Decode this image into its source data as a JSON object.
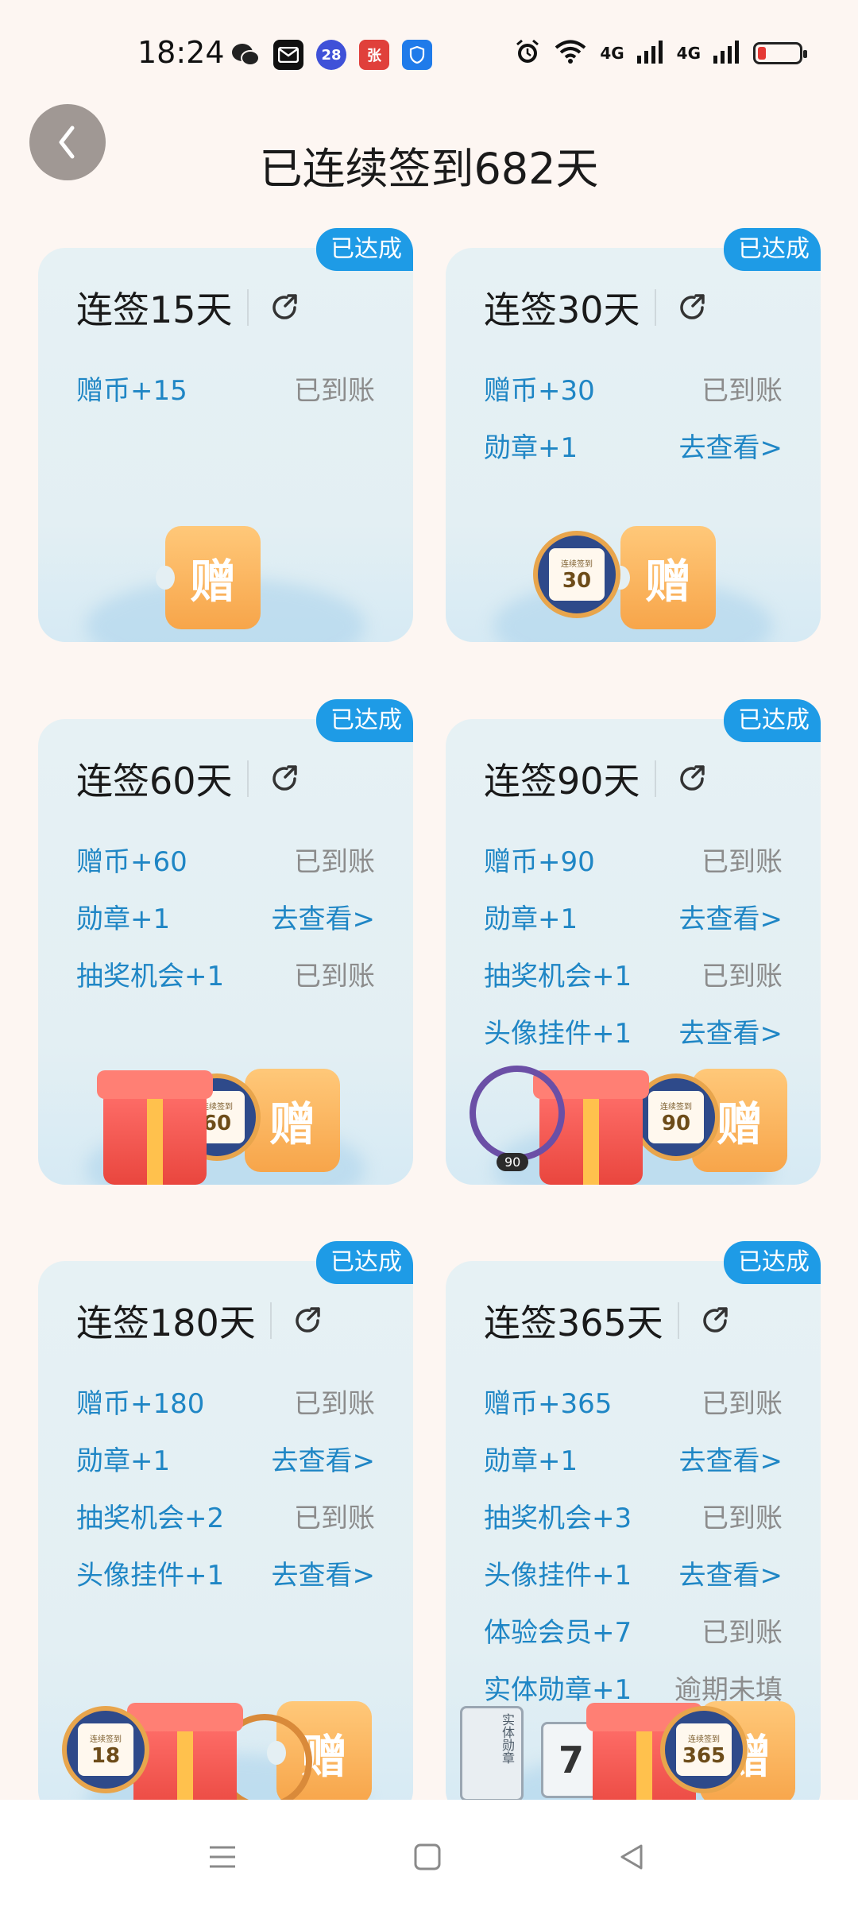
{
  "status_bar": {
    "time": "18:24",
    "app_icons": [
      {
        "name": "wechat-icon",
        "label": "",
        "color": "#222222"
      },
      {
        "name": "mail-icon",
        "label": "",
        "color": "#111111"
      },
      {
        "name": "calendar-icon",
        "label": "28",
        "color": "#3F51D8"
      },
      {
        "name": "zhang-app-icon",
        "label": "张",
        "color": "#E0403B"
      },
      {
        "name": "shield-app-icon",
        "label": "",
        "color": "#1F7BEA"
      }
    ],
    "signal1": "4G",
    "signal2": "4G",
    "battery_level": 0.2
  },
  "header": {
    "title": "已连续签到682天"
  },
  "cards": [
    {
      "badge": "已达成",
      "title": "连签15天",
      "rows": [
        {
          "label": "赠币+15",
          "status": "已到账",
          "link": false
        }
      ]
    },
    {
      "badge": "已达成",
      "title": "连签30天",
      "rows": [
        {
          "label": "赠币+30",
          "status": "已到账",
          "link": false
        },
        {
          "label": "勋章+1",
          "status": "去查看>",
          "link": true
        }
      ]
    },
    {
      "badge": "已达成",
      "title": "连签60天",
      "rows": [
        {
          "label": "赠币+60",
          "status": "已到账",
          "link": false
        },
        {
          "label": "勋章+1",
          "status": "去查看>",
          "link": true
        },
        {
          "label": "抽奖机会+1",
          "status": "已到账",
          "link": false
        }
      ]
    },
    {
      "badge": "已达成",
      "title": "连签90天",
      "rows": [
        {
          "label": "赠币+90",
          "status": "已到账",
          "link": false
        },
        {
          "label": "勋章+1",
          "status": "去查看>",
          "link": true
        },
        {
          "label": "抽奖机会+1",
          "status": "已到账",
          "link": false
        },
        {
          "label": "头像挂件+1",
          "status": "去查看>",
          "link": true
        }
      ]
    },
    {
      "badge": "已达成",
      "title": "连签180天",
      "rows": [
        {
          "label": "赠币+180",
          "status": "已到账",
          "link": false
        },
        {
          "label": "勋章+1",
          "status": "去查看>",
          "link": true
        },
        {
          "label": "抽奖机会+2",
          "status": "已到账",
          "link": false
        },
        {
          "label": "头像挂件+1",
          "status": "去查看>",
          "link": true
        }
      ]
    },
    {
      "badge": "已达成",
      "title": "连签365天",
      "rows": [
        {
          "label": "赠币+365",
          "status": "已到账",
          "link": false
        },
        {
          "label": "勋章+1",
          "status": "去查看>",
          "link": true
        },
        {
          "label": "抽奖机会+3",
          "status": "已到账",
          "link": false
        },
        {
          "label": "头像挂件+1",
          "status": "去查看>",
          "link": true
        },
        {
          "label": "体验会员+7",
          "status": "已到账",
          "link": false
        },
        {
          "label": "实体勋章+1",
          "status": "逾期未填",
          "link": false
        }
      ]
    }
  ],
  "illustrations": {
    "ticket_char": "赠",
    "medal_caption": "连续签到",
    "medal_30": "30",
    "medal_60": "60",
    "medal_90": "90",
    "ring_tag_90": "90",
    "medal_180": "18",
    "medal_365": "365",
    "box_text": "实体勋章",
    "cal_7": "7"
  },
  "nav": {
    "buttons": [
      "menu-icon",
      "home-square-icon",
      "back-triangle-icon"
    ]
  }
}
